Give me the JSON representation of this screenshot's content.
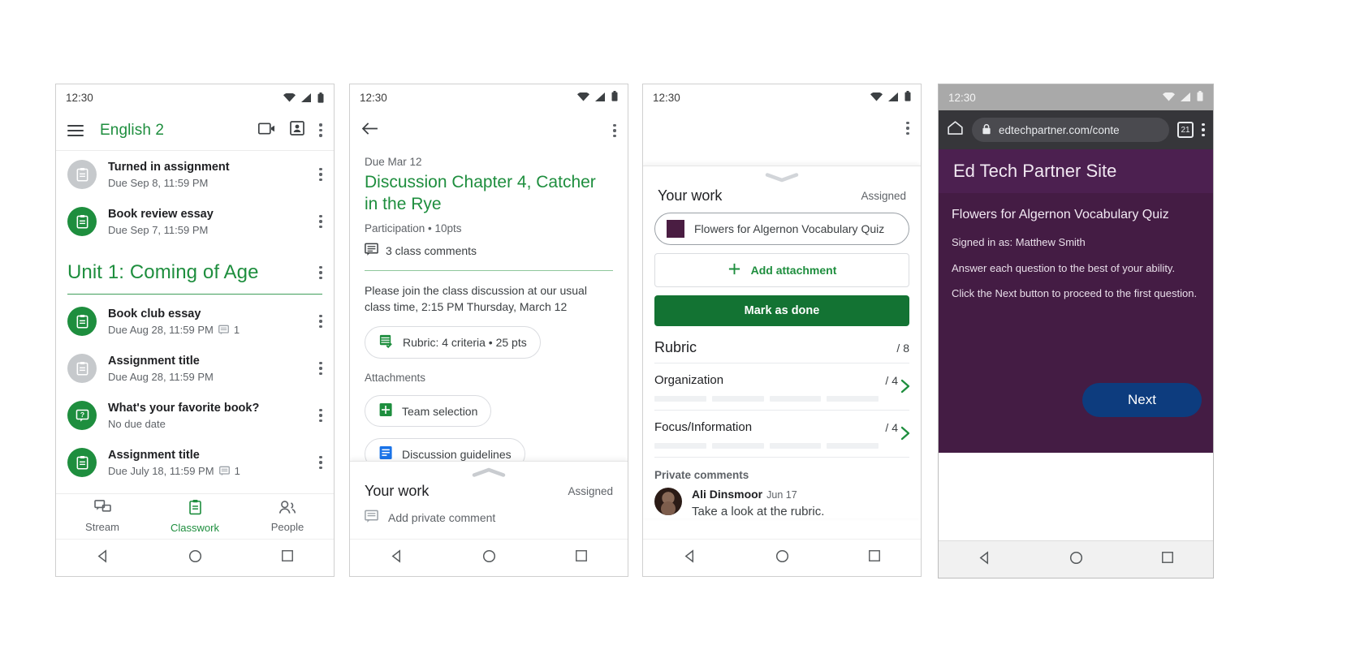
{
  "phone1": {
    "status": {
      "time": "12:30",
      "icons": [
        "wifi-icon",
        "signal-icon",
        "battery-icon"
      ]
    },
    "appbar": {
      "menu_icon": "hamburger-menu-icon",
      "title": "English 2",
      "meet_icon": "video-camera-icon",
      "roster_icon": "id-card-icon",
      "overflow_icon": "kebab-menu-icon"
    },
    "top_items": [
      {
        "title": "Turned in assignment",
        "subtitle": "Due Sep 8, 11:59 PM",
        "icon": "assignment-icon",
        "state": "grey",
        "comments": ""
      },
      {
        "title": "Book review essay",
        "subtitle": "Due Sep 7, 11:59 PM",
        "icon": "assignment-icon",
        "state": "green",
        "comments": ""
      }
    ],
    "unit": {
      "title": "Unit 1: Coming of Age",
      "overflow_icon": "kebab-menu-icon"
    },
    "unit_items": [
      {
        "title": "Book club essay",
        "subtitle": "Due Aug 28, 11:59 PM",
        "icon": "assignment-icon",
        "state": "green",
        "comments": "1"
      },
      {
        "title": "Assignment title",
        "subtitle": "Due Aug 28, 11:59 PM",
        "icon": "assignment-icon",
        "state": "grey",
        "comments": ""
      },
      {
        "title": "What's your favorite book?",
        "subtitle": "No due date",
        "icon": "question-icon",
        "state": "green",
        "comments": ""
      },
      {
        "title": "Assignment title",
        "subtitle": "Due July 18, 11:59 PM",
        "icon": "assignment-icon",
        "state": "green",
        "comments": "1"
      }
    ],
    "bottom_nav": [
      {
        "label": "Stream",
        "icon": "stream-icon",
        "active": false
      },
      {
        "label": "Classwork",
        "icon": "classwork-icon",
        "active": true
      },
      {
        "label": "People",
        "icon": "people-icon",
        "active": false
      }
    ]
  },
  "phone2": {
    "status": {
      "time": "12:30"
    },
    "appbar": {
      "back_icon": "back-arrow-icon",
      "overflow_icon": "kebab-menu-icon"
    },
    "due": "Due Mar 12",
    "title": "Discussion Chapter 4, Catcher in the Rye",
    "meta": "Participation • 10pts",
    "class_comments": "3 class comments",
    "body": "Please join the class discussion at our usual class time, 2:15 PM Thursday, March 12",
    "rubric_chip": "Rubric: 4 criteria • 25 pts",
    "attachments_label": "Attachments",
    "attachments": [
      {
        "label": "Team selection",
        "icon": "google-sheets-icon"
      },
      {
        "label": "Discussion guidelines",
        "icon": "google-docs-icon"
      }
    ],
    "sheet": {
      "title": "Your work",
      "status": "Assigned",
      "private_comment_placeholder": "Add private comment",
      "comment_icon": "comment-icon"
    }
  },
  "phone3": {
    "status": {
      "time": "12:30"
    },
    "appbar": {
      "overflow_icon": "kebab-menu-icon"
    },
    "sheet": {
      "title": "Your work",
      "status": "Assigned",
      "work_item": "Flowers for Algernon Vocabulary Quiz",
      "add_attachment": "Add attachment",
      "mark_as_done": "Mark as done"
    },
    "rubric": {
      "title": "Rubric",
      "total_score": "/ 8",
      "criteria": [
        {
          "name": "Organization",
          "score": "/ 4",
          "levels": 4
        },
        {
          "name": "Focus/Information",
          "score": "/ 4",
          "levels": 4
        }
      ]
    },
    "private_comments": {
      "label": "Private comments",
      "items": [
        {
          "author": "Ali Dinsmoor",
          "date": "Jun 17",
          "text": "Take a look at the rubric."
        }
      ]
    }
  },
  "phone4": {
    "status": {
      "time": "12:30"
    },
    "browser": {
      "home_icon": "home-icon",
      "lock_icon": "lock-icon",
      "url": "edtechpartner.com/conte",
      "tab_count": "21",
      "overflow_icon": "kebab-menu-icon"
    },
    "page": {
      "site_title": "Ed Tech Partner Site",
      "heading": "Flowers for Algernon Vocabulary Quiz",
      "lines": [
        "Signed in as: Matthew Smith",
        "Answer each question to the best of your ability.",
        "Click the Next button to proceed to the first question."
      ],
      "next_button": "Next"
    }
  },
  "colors": {
    "classroom_green": "#1e8e3e",
    "dark_green": "#137333",
    "purple_header": "#4c2050",
    "purple_body": "#441c44",
    "blue_button": "#0d3c7e",
    "grey_badge": "#c6c9cc"
  }
}
